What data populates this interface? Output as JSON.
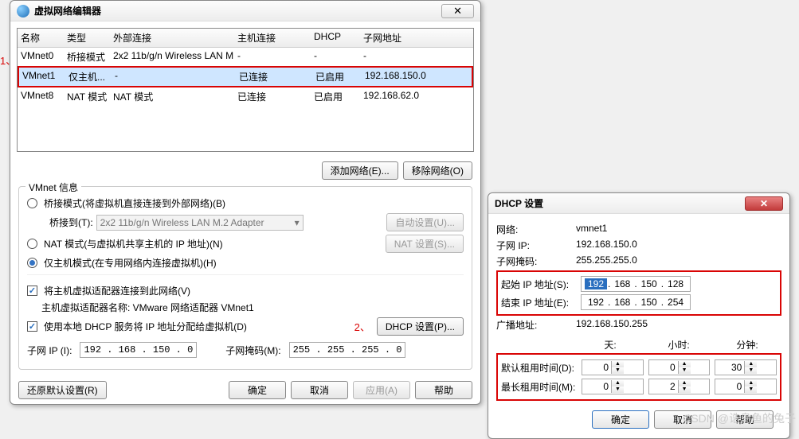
{
  "annotations": {
    "one": "1、",
    "two": "2、"
  },
  "main": {
    "title": "虚拟网络编辑器",
    "closeGlyph": "✕",
    "columns": {
      "name": "名称",
      "type": "类型",
      "ext": "外部连接",
      "host": "主机连接",
      "dhcp": "DHCP",
      "subnet": "子网地址"
    },
    "rows": [
      {
        "name": "VMnet0",
        "type": "桥接模式",
        "ext": "2x2 11b/g/n Wireless LAN M...",
        "host": "-",
        "dhcp": "-",
        "subnet": "-"
      },
      {
        "name": "VMnet1",
        "type": "仅主机...",
        "ext": "-",
        "host": "已连接",
        "dhcp": "已启用",
        "subnet": "192.168.150.0"
      },
      {
        "name": "VMnet8",
        "type": "NAT 模式",
        "ext": "NAT 模式",
        "host": "已连接",
        "dhcp": "已启用",
        "subnet": "192.168.62.0"
      }
    ],
    "addNet": "添加网络(E)...",
    "removeNet": "移除网络(O)",
    "groupTitle": "VMnet 信息",
    "bridged": "桥接模式(将虚拟机直接连接到外部网络)(B)",
    "bridgedToLabel": "桥接到(T):",
    "bridgedToValue": "2x2 11b/g/n Wireless LAN M.2 Adapter",
    "autoSet": "自动设置(U)...",
    "nat": "NAT 模式(与虚拟机共享主机的 IP 地址)(N)",
    "natSet": "NAT 设置(S)...",
    "hostonly": "仅主机模式(在专用网络内连接虚拟机)(H)",
    "connectAdapter": "将主机虚拟适配器连接到此网络(V)",
    "adapterName": "主机虚拟适配器名称: VMware 网络适配器 VMnet1",
    "useDhcp": "使用本地 DHCP 服务将 IP 地址分配给虚拟机(D)",
    "dhcpSet": "DHCP 设置(P)...",
    "subnetIpLabel": "子网 IP (I):",
    "subnetIpValue": "192 . 168 . 150 .   0",
    "subnetMaskLabel": "子网掩码(M):",
    "subnetMaskValue": "255 . 255 . 255 .   0",
    "restore": "还原默认设置(R)",
    "ok": "确定",
    "cancel": "取消",
    "apply": "应用(A)",
    "help": "帮助"
  },
  "dhcp": {
    "title": "DHCP 设置",
    "closeGlyph": "✕",
    "netLabel": "网络:",
    "netVal": "vmnet1",
    "subLabel": "子网 IP:",
    "subVal": "192.168.150.0",
    "maskLabel": "子网掩码:",
    "maskVal": "255.255.255.0",
    "startLabel": "起始 IP 地址(S):",
    "startIp": {
      "o1": "192",
      "o2": "168",
      "o3": "150",
      "o4": "128"
    },
    "endLabel": "结束 IP 地址(E):",
    "endIp": {
      "o1": "192",
      "o2": "168",
      "o3": "150",
      "o4": "254"
    },
    "bcastLabel": "广播地址:",
    "bcastVal": "192.168.150.255",
    "days": "天:",
    "hours": "小时:",
    "minutes": "分钟:",
    "defLease": "默认租用时间(D):",
    "defVals": {
      "d": "0",
      "h": "0",
      "m": "30"
    },
    "maxLease": "最长租用时间(M):",
    "maxVals": {
      "d": "0",
      "h": "2",
      "m": "0"
    },
    "ok": "确定",
    "cancel": "取消",
    "help": "帮助"
  },
  "watermark": "CSDN @诰鸟鱼的兔子"
}
